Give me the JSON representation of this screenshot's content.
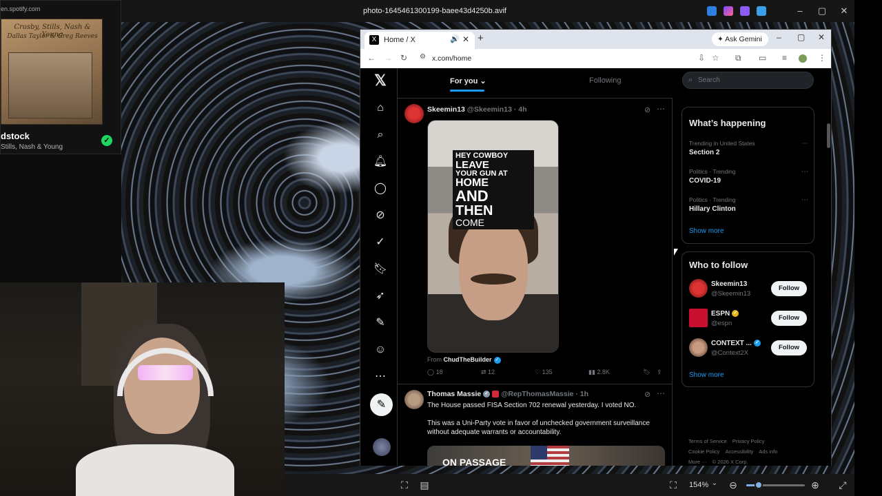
{
  "viewer": {
    "title": "photo-1645461300199-baee43d4250b.avif",
    "zoom": "154%",
    "minimize": "–",
    "maximize": "▢",
    "close": "✕"
  },
  "spotify": {
    "url": "en.spotify.com",
    "album_line1": "Crosby, Stills, Nash & Young",
    "album_line2": "Dallas Taylor & Greg Reeves",
    "track": "dstock",
    "artist": "Stills, Nash & Young"
  },
  "browser": {
    "tab_title": "Home / X",
    "ask_gemini": "Ask Gemini",
    "url": "x.com/home"
  },
  "x": {
    "tabs": {
      "for_you": "For you",
      "following": "Following"
    },
    "posts": [
      {
        "name": "Skeemin13",
        "handle": "@Skeemin13 · 4h",
        "caption": [
          "HEY COWBOY",
          "LEAVE",
          "YOUR GUN AT",
          "HOME",
          "AND",
          "THEN",
          "COME"
        ],
        "from_prefix": "From",
        "from_name": "ChudTheBuilder",
        "replies": "18",
        "reposts": "12",
        "likes": "135",
        "views": "2.8K"
      },
      {
        "name": "Thomas Massie",
        "handle": "@RepThomasMassie · 1h",
        "text1": "The House passed FISA Section 702 renewal yesterday. I voted NO.",
        "text2": "This was a Uni-Party vote in favor of unchecked government surveillance without adequate warrants or accountability.",
        "media_text": "ON PASSAGE"
      }
    ],
    "search_placeholder": "Search",
    "whats_happening": {
      "title": "What’s happening",
      "trends": [
        {
          "meta": "Trending in United States",
          "name": "Section 2"
        },
        {
          "meta": "Politics · Trending",
          "name": "COVID-19"
        },
        {
          "meta": "Politics · Trending",
          "name": "Hillary Clinton"
        }
      ],
      "show_more": "Show more"
    },
    "who_to_follow": {
      "title": "Who to follow",
      "accounts": [
        {
          "name": "Skeemin13",
          "handle": "@Skeemin13",
          "button": "Follow"
        },
        {
          "name": "ESPN",
          "handle": "@espn",
          "button": "Follow"
        },
        {
          "name": "CONTEXT ...",
          "handle": "@Context2X",
          "button": "Follow"
        }
      ],
      "show_more": "Show more"
    },
    "footer": {
      "terms": "Terms of Service",
      "privacy": "Privacy Policy",
      "cookie": "Cookie Policy",
      "accessibility": "Accessibility",
      "ads": "Ads info",
      "more": "More ···",
      "copyright": "© 2026 X Corp."
    }
  },
  "colors": {
    "accent": "#1d9bf0",
    "spotify_green": "#1ed760",
    "verified_gold": "#e2b719"
  }
}
